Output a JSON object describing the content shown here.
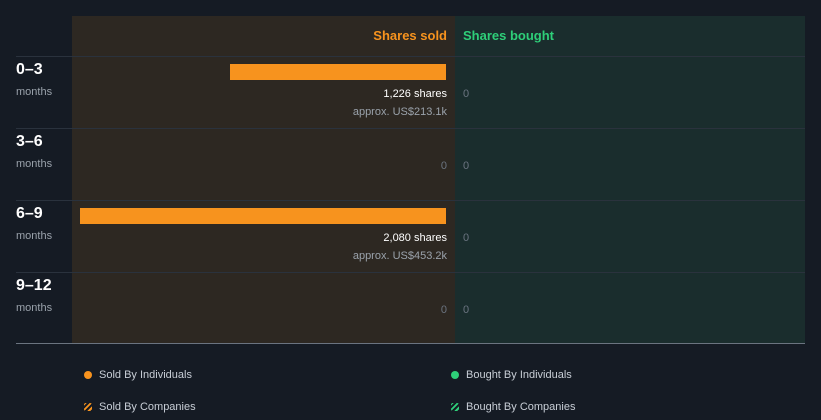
{
  "columns": {
    "sold": "Shares sold",
    "bought": "Shares bought"
  },
  "colors": {
    "sold": "#f7931e",
    "bought": "#2ecf79"
  },
  "chart_data": {
    "type": "bar",
    "categories": [
      "0–3",
      "3–6",
      "6–9",
      "9–12"
    ],
    "category_unit": "months",
    "series": [
      {
        "name": "Shares sold",
        "values": [
          1226,
          0,
          2080,
          0
        ]
      },
      {
        "name": "Shares bought",
        "values": [
          0,
          0,
          0,
          0
        ]
      }
    ],
    "sold_labels": [
      {
        "shares": "1,226 shares",
        "approx": "approx. US$213.1k"
      },
      {
        "shares": "",
        "approx": ""
      },
      {
        "shares": "2,080 shares",
        "approx": "approx. US$453.2k"
      },
      {
        "shares": "",
        "approx": ""
      }
    ],
    "zero_label": "0",
    "sold_max": 2080
  },
  "legend": [
    {
      "label": "Sold By Individuals",
      "icon": "dot-icon",
      "color": "#f7931e"
    },
    {
      "label": "Bought By Individuals",
      "icon": "dot-icon",
      "color": "#2ecf79"
    },
    {
      "label": "Sold By Companies",
      "icon": "hatch-icon",
      "color": "#f7931e"
    },
    {
      "label": "Bought By Companies",
      "icon": "hatch-icon",
      "color": "#2ecf79"
    }
  ]
}
